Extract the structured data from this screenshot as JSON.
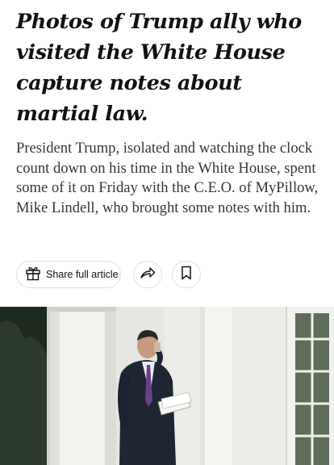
{
  "article": {
    "headline": "Photos of Trump ally who visited the White House capture notes about martial law.",
    "summary": "President Trump, isolated and watching the clock count down on his time in the White House, spent some of it on Friday with the C.E.O. of MyPillow, Mike Lindell, who brought some notes with him."
  },
  "toolbar": {
    "share_full_label": "Share full article",
    "share_icon": "share-arrow-icon",
    "save_icon": "bookmark-icon",
    "gift_icon": "gift-icon"
  },
  "photo": {
    "subject": "man in dark suit holding papers outside white columned building"
  }
}
